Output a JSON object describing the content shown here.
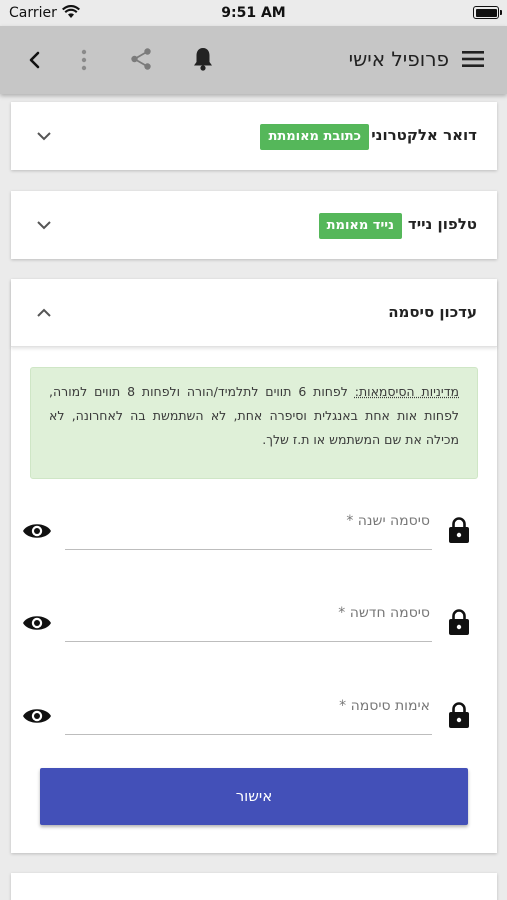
{
  "status_bar": {
    "carrier": "Carrier",
    "time": "9:51 AM"
  },
  "app_bar": {
    "title": "פרופיל אישי",
    "icons": [
      "menu-icon",
      "bell-icon",
      "share-icon",
      "more-vert-icon",
      "back-icon"
    ]
  },
  "sections": {
    "email": {
      "title": "דואר אלקטרוני",
      "badge": "כתובת מאומתת",
      "expanded": false
    },
    "phone": {
      "title": "טלפון נייד",
      "badge": "נייד מאומת",
      "expanded": false
    },
    "password": {
      "title": "עדכון סיסמה",
      "expanded": true,
      "policy_term": "מדיניות הסיסמאות:",
      "policy_text": "לפחות 6 תווים לתלמיד/הורה ולפחות 8 תווים למורה, לפחות אות אחת באנגלית וסיפרה אחת, לא השתמשת בה לאחרונה, לא מכילה את שם המשתמש או ת.ז שלך.",
      "fields": {
        "old": {
          "label": "סיסמה ישנה *"
        },
        "new": {
          "label": "סיסמה חדשה *"
        },
        "confirm": {
          "label": "אימות סיסמה *"
        }
      },
      "submit_label": "אישור"
    }
  },
  "colors": {
    "badge_green": "#55b75a",
    "primary_button": "#4350b8",
    "policy_background": "#dff0d8",
    "app_bar": "#c6c6c6"
  }
}
